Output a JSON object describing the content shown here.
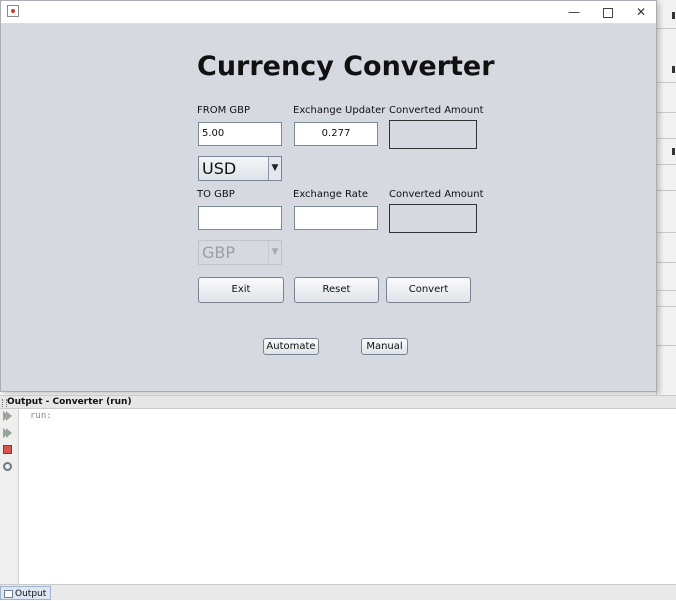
{
  "app": {
    "title": "Currency Converter",
    "window_buttons": {
      "minimize": "—",
      "close": "✕"
    }
  },
  "form": {
    "from_label": "FROM GBP",
    "from_value": "5.00",
    "exchange_updater_label": "Exchange Updater",
    "exchange_updater_value": "0.277",
    "converted_amount_label_1": "Converted Amount",
    "currency_select_1": "USD",
    "to_label": "TO GBP",
    "to_value": "",
    "exchange_rate_label": "Exchange Rate",
    "exchange_rate_value": "",
    "converted_amount_label_2": "Converted Amount",
    "currency_select_2": "GBP",
    "currency_select_2_disabled": true
  },
  "buttons": {
    "exit": "Exit",
    "reset": "Reset",
    "convert": "Convert",
    "automate": "Automate",
    "manual": "Manual"
  },
  "output_panel": {
    "header": "Output - Converter (run)",
    "text": "run:",
    "tab_label": "Output"
  },
  "colors": {
    "window_bg": "#d6d9e0",
    "stop_red": "#d9534f"
  },
  "icons": {
    "combo_arrow": "▼"
  }
}
